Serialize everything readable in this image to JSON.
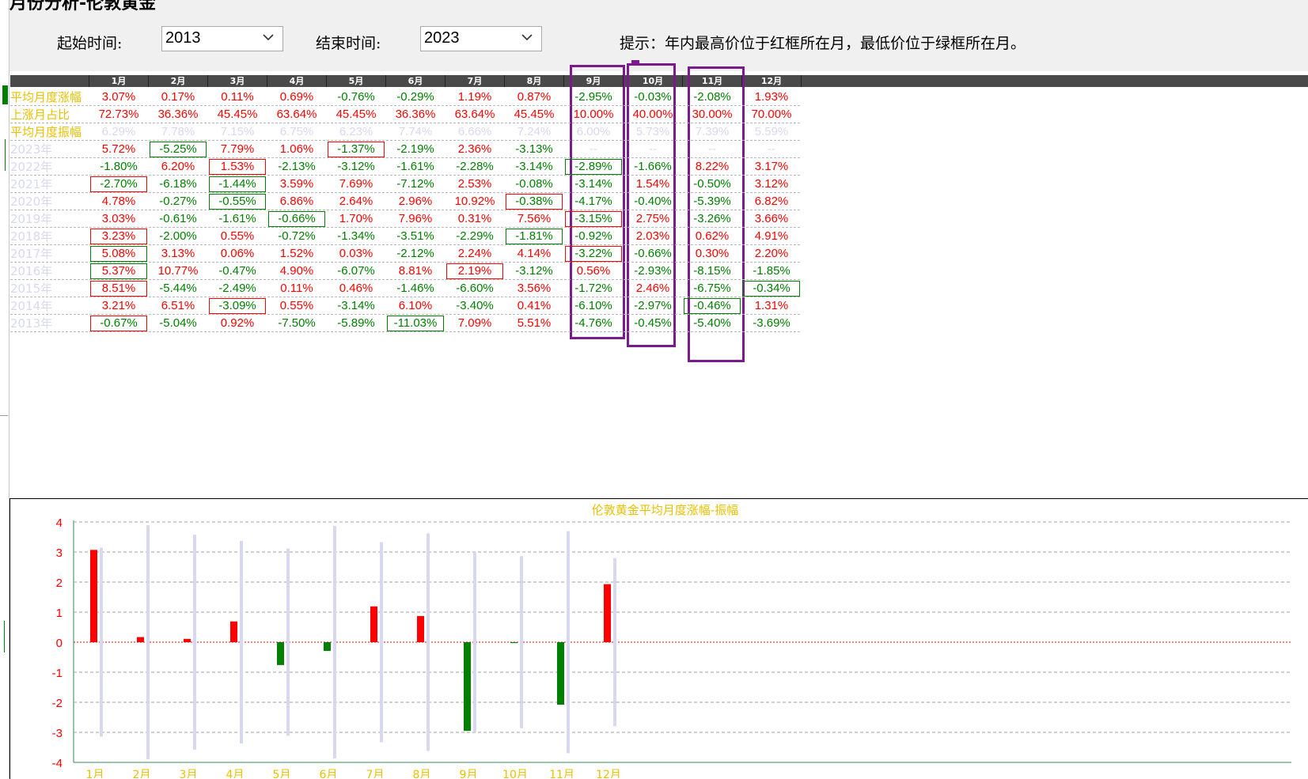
{
  "window": {
    "title_fragment": "月份分析-伦敦黄金"
  },
  "filters": {
    "start_label": "起始时间:",
    "start_value": "2013",
    "end_label": "结束时间:",
    "end_value": "2023",
    "hint": "提示：年内最高价位于红框所在月，最低价位于绿框所在月。"
  },
  "table": {
    "months": [
      "1月",
      "2月",
      "3月",
      "4月",
      "5月",
      "6月",
      "7月",
      "8月",
      "9月",
      "10月",
      "11月",
      "12月"
    ],
    "rows": [
      {
        "label": "平均月度涨幅",
        "label_color": "yellow",
        "values": [
          "3.07%",
          "0.17%",
          "0.11%",
          "0.69%",
          "-0.76%",
          "-0.29%",
          "1.19%",
          "0.87%",
          "-2.95%",
          "-0.03%",
          "-2.08%",
          "1.93%"
        ]
      },
      {
        "label": "上涨月占比",
        "label_color": "yellow",
        "values": [
          "72.73%",
          "36.36%",
          "45.45%",
          "63.64%",
          "45.45%",
          "36.36%",
          "63.64%",
          "45.45%",
          "10.00%",
          "40.00%",
          "30.00%",
          "70.00%"
        ]
      },
      {
        "label": "平均月度振幅",
        "label_color": "yellow",
        "values": [
          "6.29%",
          "7.78%",
          "7.15%",
          "6.75%",
          "6.23%",
          "7.74%",
          "6.66%",
          "7.24%",
          "6.00%",
          "5.73%",
          "7.39%",
          "5.59%"
        ]
      },
      {
        "label": "2023年",
        "values": [
          "5.72%",
          "-5.25%",
          "7.79%",
          "1.06%",
          "-1.37%",
          "-2.19%",
          "2.36%",
          "-3.13%",
          "--",
          "--",
          "--",
          "--"
        ],
        "boxes": {
          "1": "green",
          "4": "red"
        }
      },
      {
        "label": "2022年",
        "values": [
          "-1.80%",
          "6.20%",
          "1.53%",
          "-2.13%",
          "-3.12%",
          "-1.61%",
          "-2.28%",
          "-3.14%",
          "-2.89%",
          "-1.66%",
          "8.22%",
          "3.17%"
        ],
        "boxes": {
          "2": "red",
          "8": "green"
        }
      },
      {
        "label": "2021年",
        "values": [
          "-2.70%",
          "-6.18%",
          "-1.44%",
          "3.59%",
          "7.69%",
          "-7.12%",
          "2.53%",
          "-0.08%",
          "-3.14%",
          "1.54%",
          "-0.50%",
          "3.12%"
        ],
        "boxes": {
          "0": "red",
          "2": "green"
        }
      },
      {
        "label": "2020年",
        "values": [
          "4.78%",
          "-0.27%",
          "-0.55%",
          "6.86%",
          "2.64%",
          "2.96%",
          "10.92%",
          "-0.38%",
          "-4.17%",
          "-0.40%",
          "-5.39%",
          "6.82%"
        ],
        "boxes": {
          "2": "green",
          "7": "red"
        }
      },
      {
        "label": "2019年",
        "values": [
          "3.03%",
          "-0.61%",
          "-1.61%",
          "-0.66%",
          "1.70%",
          "7.96%",
          "0.31%",
          "7.56%",
          "-3.15%",
          "2.75%",
          "-3.26%",
          "3.66%"
        ],
        "boxes": {
          "3": "green",
          "8": "red"
        }
      },
      {
        "label": "2018年",
        "values": [
          "3.23%",
          "-2.00%",
          "0.55%",
          "-0.72%",
          "-1.34%",
          "-3.51%",
          "-2.29%",
          "-1.81%",
          "-0.92%",
          "2.03%",
          "0.62%",
          "4.91%"
        ],
        "boxes": {
          "0": "red",
          "7": "green"
        }
      },
      {
        "label": "2017年",
        "values": [
          "5.08%",
          "3.13%",
          "0.06%",
          "1.52%",
          "0.03%",
          "-2.12%",
          "2.24%",
          "4.14%",
          "-3.22%",
          "-0.66%",
          "0.30%",
          "2.20%"
        ],
        "boxes": {
          "0": "green",
          "8": "red"
        }
      },
      {
        "label": "2016年",
        "values": [
          "5.37%",
          "10.77%",
          "-0.47%",
          "4.90%",
          "-6.07%",
          "8.81%",
          "2.19%",
          "-3.12%",
          "0.56%",
          "-2.93%",
          "-8.15%",
          "-1.85%"
        ],
        "boxes": {
          "0": "green",
          "6": "red"
        }
      },
      {
        "label": "2015年",
        "values": [
          "8.51%",
          "-5.44%",
          "-2.49%",
          "0.11%",
          "0.46%",
          "-1.46%",
          "-6.60%",
          "3.56%",
          "-1.72%",
          "2.46%",
          "-6.75%",
          "-0.34%"
        ],
        "boxes": {
          "0": "red",
          "11": "green"
        }
      },
      {
        "label": "2014年",
        "values": [
          "3.21%",
          "6.51%",
          "-3.09%",
          "0.55%",
          "-3.14%",
          "6.10%",
          "-3.40%",
          "0.41%",
          "-6.10%",
          "-2.97%",
          "-0.46%",
          "1.31%"
        ],
        "boxes": {
          "2": "red",
          "10": "green"
        }
      },
      {
        "label": "2013年",
        "values": [
          "-0.67%",
          "-5.04%",
          "0.92%",
          "-7.50%",
          "-5.89%",
          "-11.03%",
          "7.09%",
          "5.51%",
          "-4.76%",
          "-0.45%",
          "-5.40%",
          "-3.69%"
        ],
        "boxes": {
          "0": "red",
          "5": "green"
        }
      }
    ]
  },
  "colors": {
    "up": "#ff0000",
    "down": "#008000",
    "muted": "#d8d8ee",
    "label": "#e8c000",
    "highlight": "#7b1a8e",
    "amplitude": "#d8d8f0"
  },
  "chart_data": {
    "type": "bar",
    "title": "伦敦黄金平均月度涨幅-振幅",
    "categories": [
      "1月",
      "2月",
      "3月",
      "4月",
      "5月",
      "6月",
      "7月",
      "8月",
      "9月",
      "10月",
      "11月",
      "12月"
    ],
    "series": [
      {
        "values": [
          3.07,
          0.17,
          0.11,
          0.69,
          -0.76,
          -0.29,
          1.19,
          0.87,
          -2.95,
          -0.03,
          -2.08,
          1.93
        ]
      },
      {
        "values": [
          6.29,
          7.78,
          7.15,
          6.75,
          6.23,
          7.74,
          6.66,
          7.24,
          6.0,
          5.73,
          7.39,
          5.59
        ]
      }
    ],
    "ylim": [
      -4,
      4
    ],
    "yticks": [
      "4",
      "3",
      "2",
      "1",
      "0",
      "-1",
      "-2",
      "-3",
      "-4"
    ],
    "grid": true
  }
}
